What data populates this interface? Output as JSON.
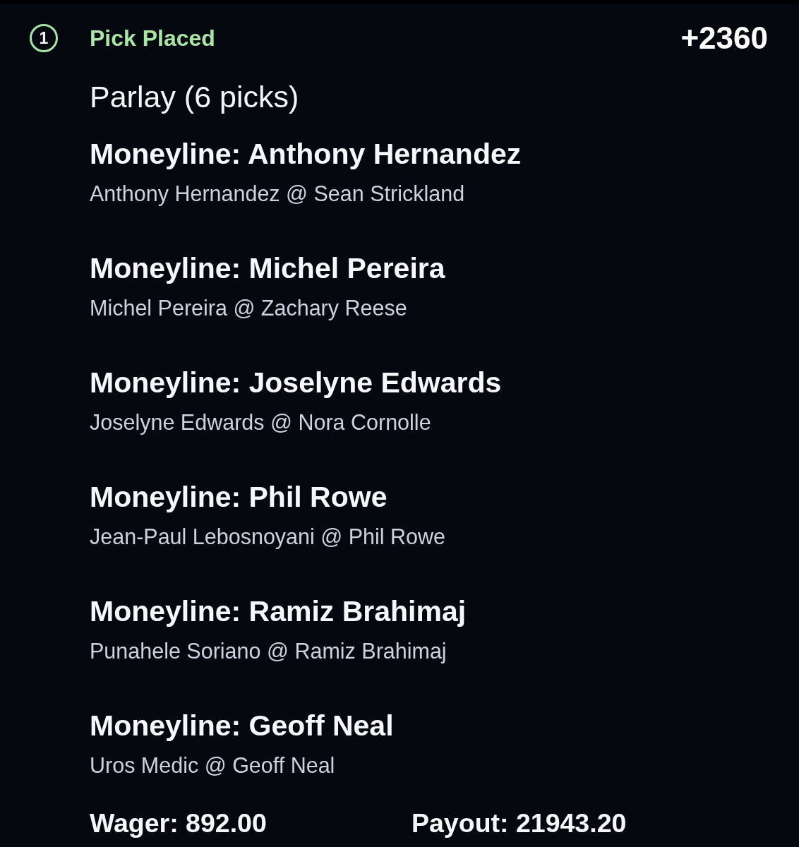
{
  "header": {
    "step": "1",
    "status": "Pick Placed",
    "odds": "+2360"
  },
  "bet": {
    "title": "Parlay (6 picks)",
    "picks": [
      {
        "market": "Moneyline: Anthony Hernandez",
        "matchup": "Anthony Hernandez @ Sean Strickland"
      },
      {
        "market": "Moneyline: Michel Pereira",
        "matchup": "Michel Pereira @ Zachary Reese"
      },
      {
        "market": "Moneyline: Joselyne Edwards",
        "matchup": "Joselyne Edwards @ Nora Cornolle"
      },
      {
        "market": "Moneyline: Phil Rowe",
        "matchup": "Jean-Paul Lebosnoyani @ Phil Rowe"
      },
      {
        "market": "Moneyline: Ramiz Brahimaj",
        "matchup": "Punahele Soriano @ Ramiz Brahimaj"
      },
      {
        "market": "Moneyline: Geoff Neal",
        "matchup": "Uros Medic @ Geoff Neal"
      }
    ]
  },
  "footer": {
    "wager": "Wager: 892.00",
    "payout": "Payout: 21943.20"
  }
}
